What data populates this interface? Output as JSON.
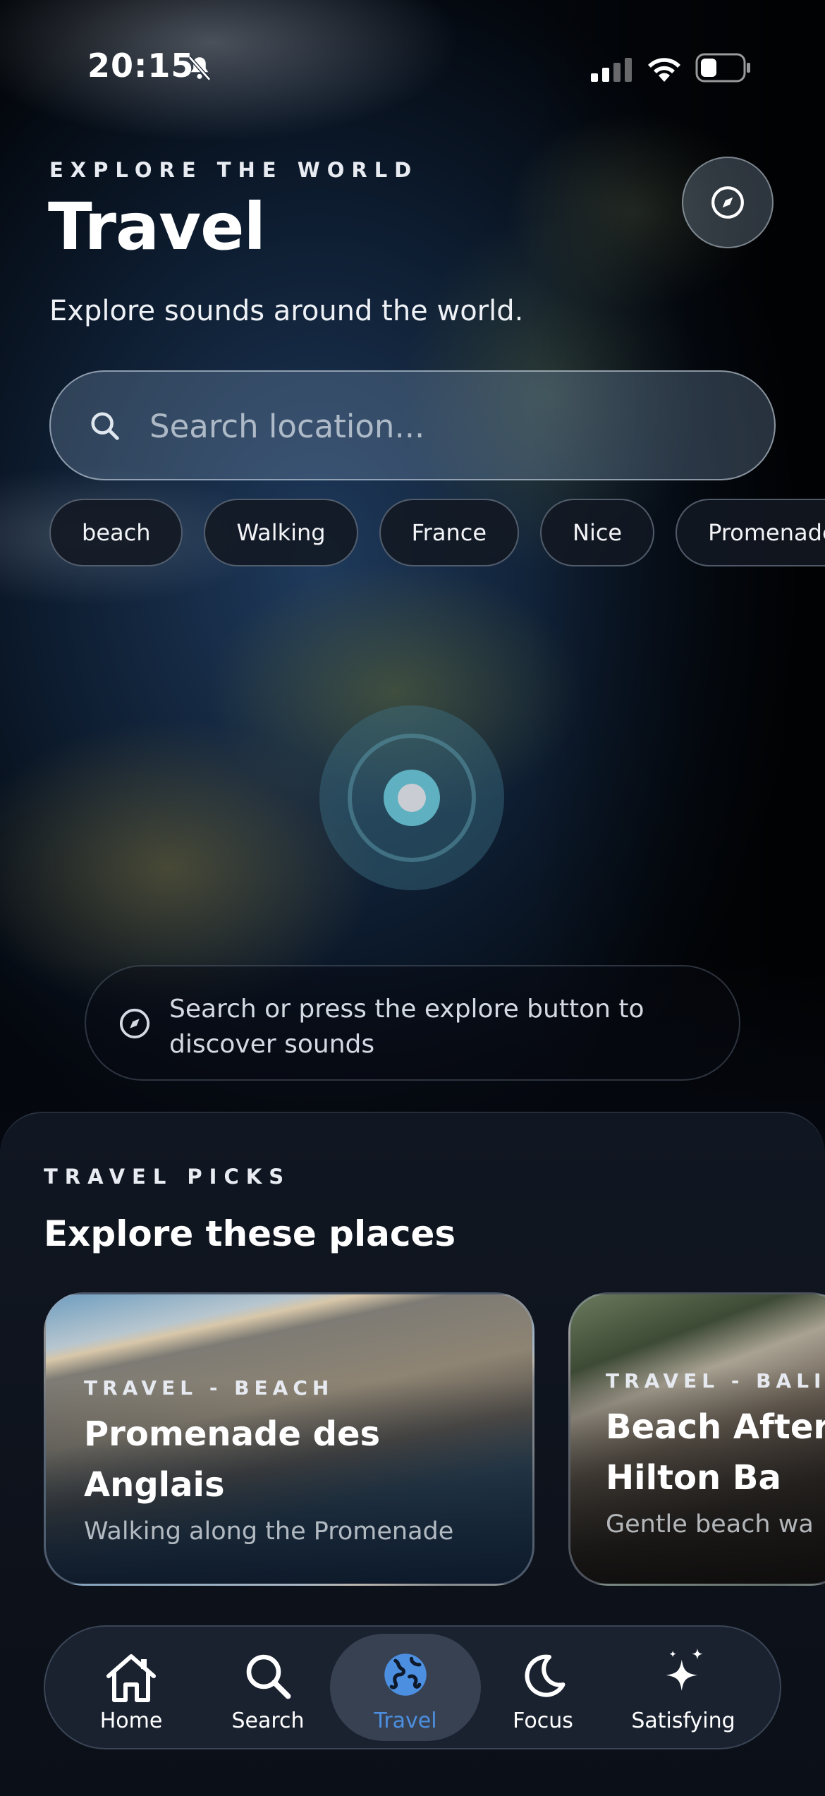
{
  "status_bar": {
    "time": "20:15"
  },
  "header": {
    "eyebrow": "EXPLORE THE WORLD",
    "title": "Travel",
    "subtitle": "Explore sounds around the world."
  },
  "search": {
    "placeholder": "Search location...",
    "value": ""
  },
  "chips": [
    "beach",
    "Walking",
    "France",
    "Nice",
    "Promenade"
  ],
  "hint": {
    "text": "Search or press the explore button to discover sounds"
  },
  "picks": {
    "eyebrow": "TRAVEL PICKS",
    "title": "Explore these places",
    "cards": [
      {
        "category": "TRAVEL - BEACH",
        "title": "Promenade des Anglais",
        "subtitle": "Walking along the Promenade"
      },
      {
        "category": "TRAVEL - BALI",
        "title": "Beach After the Hilton Ba",
        "subtitle": "Gentle beach wa"
      }
    ]
  },
  "nav": {
    "items": [
      {
        "label": "Home",
        "icon": "house-icon"
      },
      {
        "label": "Search",
        "icon": "search-icon"
      },
      {
        "label": "Travel",
        "icon": "globe-icon",
        "active": true
      },
      {
        "label": "Focus",
        "icon": "moon-icon"
      },
      {
        "label": "Satisfying",
        "icon": "sparkles-icon"
      }
    ],
    "active_color": "#4c8fe0"
  },
  "colors": {
    "background": "#05080f",
    "panel": "#111722",
    "accent": "#4c8fe0"
  }
}
